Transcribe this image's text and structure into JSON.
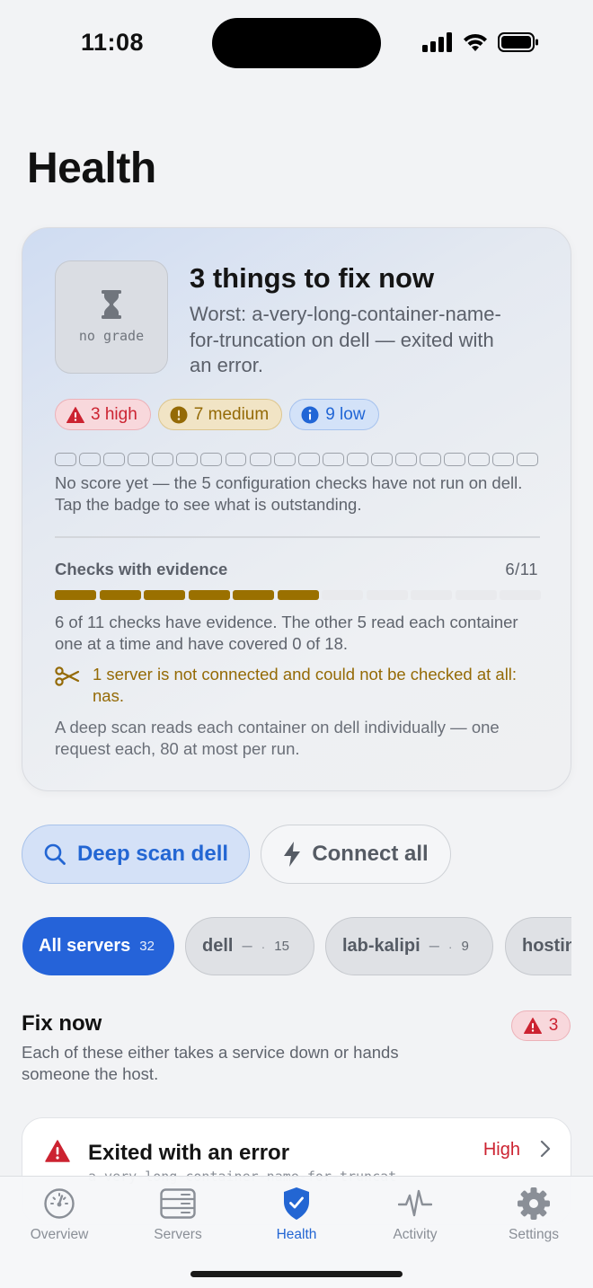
{
  "status": {
    "time": "11:08"
  },
  "page": {
    "title": "Health"
  },
  "summary": {
    "grade": "no grade",
    "headline": "3 things to fix now",
    "worst": "Worst: a-very-long-container-name-for-truncation on dell — exited with an error.",
    "severity": {
      "high": "3 high",
      "medium": "7 medium",
      "low": "9 low"
    },
    "score_segments": 20,
    "score_text": "No score yet — the 5 configuration checks have not run on dell. Tap the badge to see what is outstanding.",
    "checks_label": "Checks with evidence",
    "checks_count": "6/11",
    "checks_filled": 6,
    "checks_total": 11,
    "checks_text": "6 of 11 checks have evidence. The other 5 read each container one at a time and have covered 0 of 18.",
    "warning_text": "1 server is not connected and could not be checked at all: nas.",
    "deep_scan_text": "A deep scan reads each container on dell individually — one request each, 80 at most per run."
  },
  "actions": {
    "deep_scan": "Deep scan dell",
    "connect_all": "Connect all"
  },
  "servers": [
    {
      "name": "All servers",
      "count": "32",
      "active": true
    },
    {
      "name": "dell",
      "dash": "–",
      "dot": "·",
      "count": "15"
    },
    {
      "name": "lab-kalipi",
      "dash": "–",
      "dot": "·",
      "count": "9"
    },
    {
      "name": "hostin"
    }
  ],
  "fix_now": {
    "title": "Fix now",
    "subtitle": "Each of these either takes a service down or hands someone the host.",
    "count": "3",
    "items": [
      {
        "title": "Exited with an error",
        "subtitle": "a-very-long-container-name-for-truncat",
        "severity": "High"
      }
    ]
  },
  "tabs": [
    {
      "label": "Overview",
      "icon": "gauge-icon"
    },
    {
      "label": "Servers",
      "icon": "server-rack-icon"
    },
    {
      "label": "Health",
      "icon": "shield-check-icon",
      "active": true
    },
    {
      "label": "Activity",
      "icon": "pulse-icon"
    },
    {
      "label": "Settings",
      "icon": "gear-icon"
    }
  ],
  "colors": {
    "accent": "#2563d9",
    "high": "#cc2331",
    "medium": "#946a06",
    "low": "#2166d6"
  }
}
